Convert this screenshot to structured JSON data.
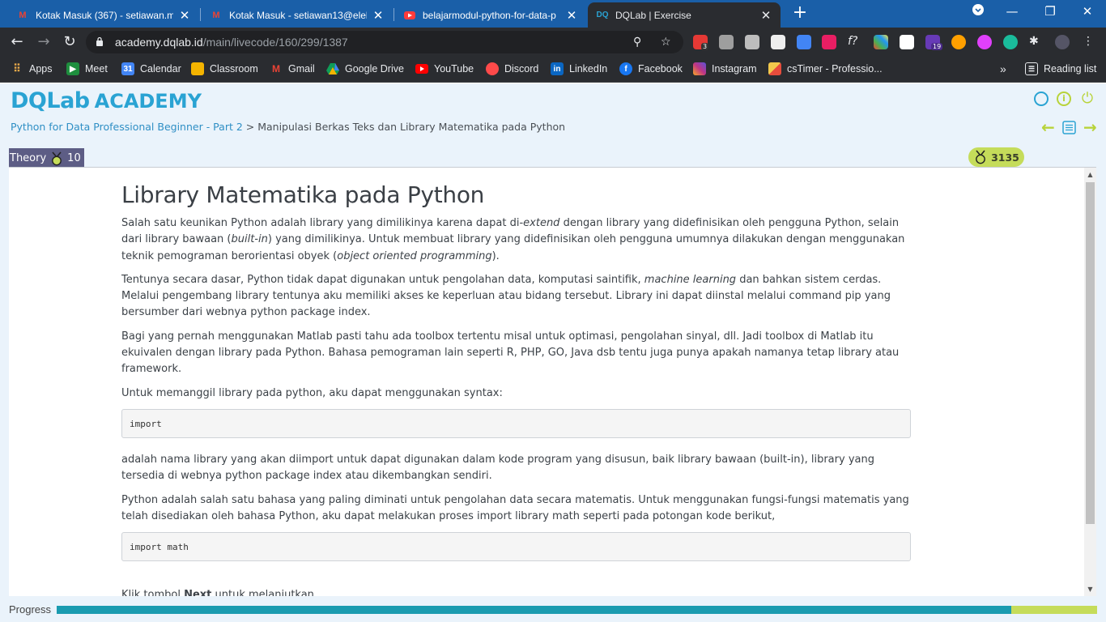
{
  "browser": {
    "tabs": [
      {
        "title": "Kotak Masuk (367) - setiawan.mo",
        "icon": "gmail-icon",
        "active": false
      },
      {
        "title": "Kotak Masuk - setiawan13@elekt",
        "icon": "gmail-icon",
        "active": false
      },
      {
        "title": "belajarmodul-python-for-data-p",
        "icon": "youtube-icon",
        "active": false
      },
      {
        "title": "DQLab | Exercise",
        "icon": "dqlab-icon",
        "active": true
      }
    ],
    "url_host": "academy.dqlab.id",
    "url_path": "/main/livecode/160/299/1387",
    "bookmarks": [
      {
        "label": "Apps",
        "icon": "apps-grid-icon",
        "color": "#e8a94a"
      },
      {
        "label": "Meet",
        "icon": "meet-icon",
        "color": "#1e8e3e"
      },
      {
        "label": "Calendar",
        "icon": "calendar-icon",
        "color": "#4285f4"
      },
      {
        "label": "Classroom",
        "icon": "classroom-icon",
        "color": "#f4b400"
      },
      {
        "label": "Gmail",
        "icon": "gmail-icon",
        "color": "#ea4335"
      },
      {
        "label": "Google Drive",
        "icon": "drive-icon",
        "color": "#0f9d58"
      },
      {
        "label": "YouTube",
        "icon": "youtube-icon",
        "color": "#ff0000"
      },
      {
        "label": "Discord",
        "icon": "discord-icon",
        "color": "#ff4a4a"
      },
      {
        "label": "LinkedIn",
        "icon": "linkedin-icon",
        "color": "#0a66c2"
      },
      {
        "label": "Facebook",
        "icon": "facebook-icon",
        "color": "#1877f2"
      },
      {
        "label": "Instagram",
        "icon": "instagram-icon",
        "color": "#c13584"
      },
      {
        "label": "csTimer - Professio...",
        "icon": "cstimer-icon",
        "color": "#f2c94c"
      }
    ],
    "overflow": "»",
    "reading_list": "Reading list"
  },
  "header": {
    "logo_dq": "DQLab",
    "logo_academy": "ACADEMY",
    "breadcrumb_course": "Python for Data Professional Beginner - Part 2",
    "breadcrumb_sep": " > ",
    "breadcrumb_chapter": "Manipulasi Berkas Teks dan Library Matematika pada Python",
    "theory_label": "Theory",
    "theory_points": "10",
    "score": "3135"
  },
  "content": {
    "title": "Library Matematika pada Python",
    "p1_a": "Salah satu keunikan Python adalah library yang dimilikinya karena dapat di-",
    "p1_b": "extend",
    "p1_c": " dengan library yang didefinisikan oleh pengguna Python, selain dari library bawaan (",
    "p1_d": "built-in",
    "p1_e": ") yang dimilikinya. Untuk membuat library yang didefinisikan oleh pengguna umumnya dilakukan dengan menggunakan teknik pemograman berorientasi obyek (",
    "p1_f": "object oriented programming",
    "p1_g": ").",
    "p2_a": "Tentunya secara dasar, Python tidak dapat digunakan untuk pengolahan data, komputasi saintifik, ",
    "p2_b": "machine learning",
    "p2_c": " dan bahkan sistem cerdas. Melalui pengembang library tentunya aku memiliki akses ke keperluan atau bidang tersebut. Library ini dapat diinstal melalui command pip yang bersumber dari webnya python package index.",
    "p3": "Bagi yang pernah menggunakan Matlab pasti tahu ada toolbox tertentu misal untuk optimasi, pengolahan sinyal, dll. Jadi toolbox di Matlab itu ekuivalen dengan library pada Python. Bahasa pemograman lain seperti R, PHP, GO, Java dsb tentu juga punya apakah namanya tetap library atau framework.",
    "p4": "Untuk memanggil library pada python, aku dapat menggunakan syntax:",
    "code1": "import",
    "p5": "adalah nama library yang akan diimport untuk dapat digunakan dalam kode program yang disusun, baik library bawaan (built-in), library yang tersedia di webnya python package index atau dikembangkan sendiri.",
    "p6": "Python adalah salah satu bahasa yang paling diminati untuk pengolahan data secara matematis. Untuk menggunakan fungsi-fungsi matematis yang telah disediakan oleh bahasa Python, aku dapat melakukan proses import library math seperti pada potongan kode berikut,",
    "code2": "import math",
    "p7_a": "Klik tombol ",
    "p7_b": "Next",
    "p7_c": " untuk melanjutkan."
  },
  "progress": {
    "label": "Progress",
    "fraction": 0.9175,
    "fill_color": "#1a9bb0",
    "track_color": "#c5dc5a"
  },
  "colors": {
    "accent": "#2aa3d3",
    "nav_green": "#b8d33a",
    "theory_bg": "#5d5d85"
  }
}
